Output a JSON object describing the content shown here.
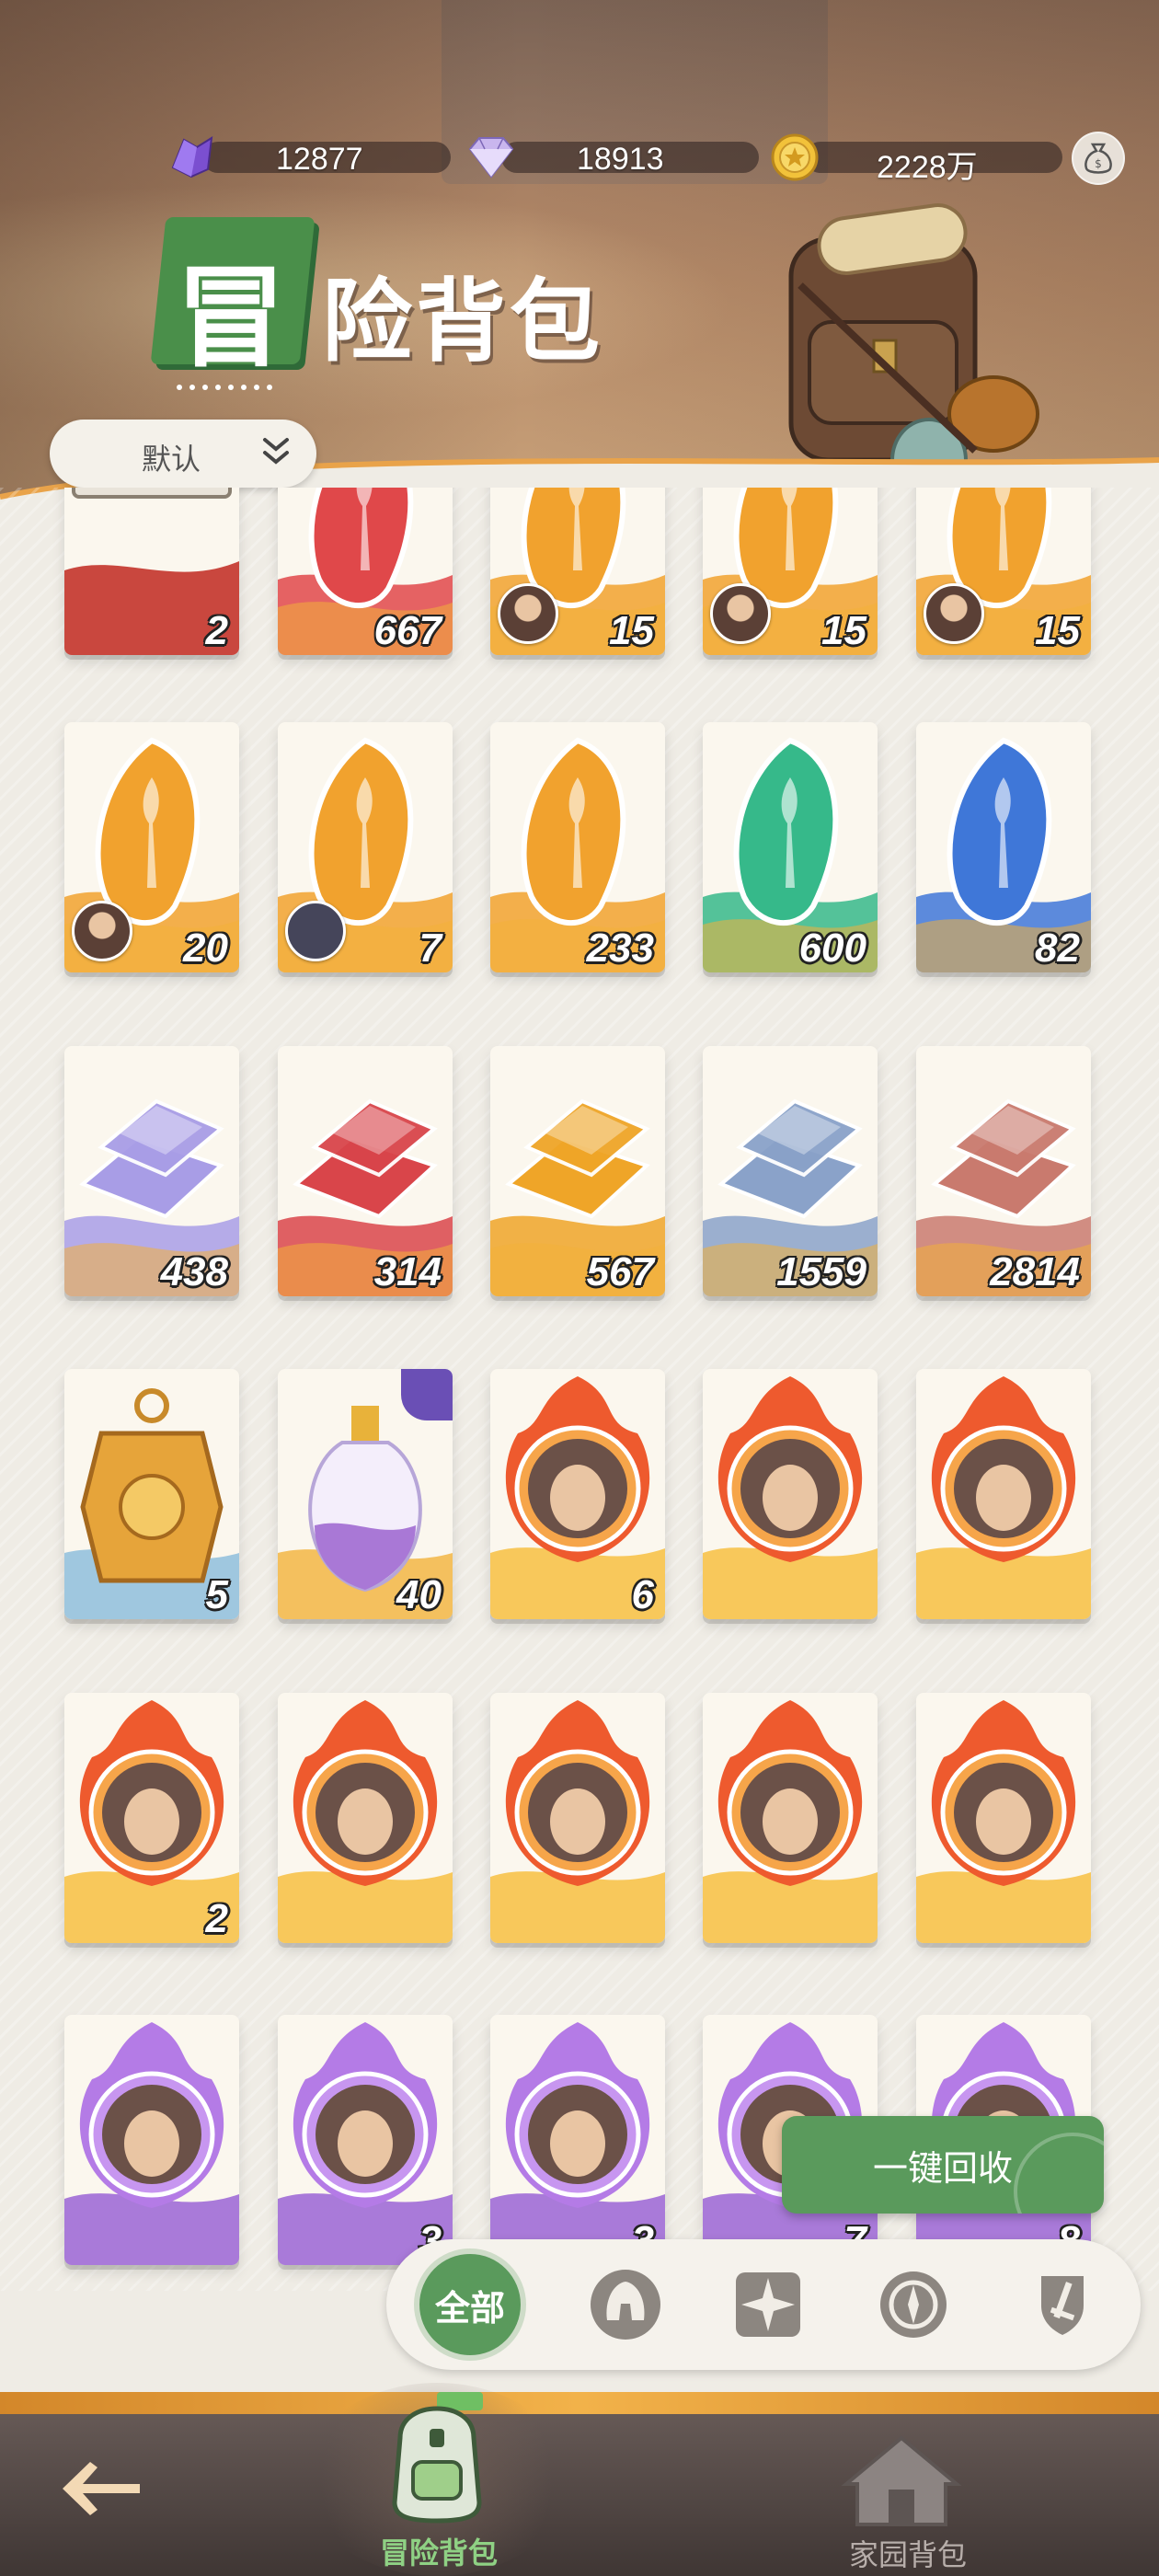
{
  "currencies": {
    "purple": {
      "value": "12877",
      "icon": "purple-crystal-icon"
    },
    "diamond": {
      "value": "18913",
      "icon": "diamond-icon"
    },
    "gold": {
      "value": "2228万",
      "icon": "gold-coin-icon"
    },
    "bag_button_icon": "money-bag-icon"
  },
  "title": {
    "first_char": "冒",
    "rest": "险背包"
  },
  "sort": {
    "label": "默认"
  },
  "items": [
    {
      "count": "2",
      "kind": "building",
      "color": "#c9543e"
    },
    {
      "count": "667",
      "kind": "shard",
      "color": "#e0484a"
    },
    {
      "count": "15",
      "kind": "shard",
      "color": "#f1a22e",
      "badge": "avatar"
    },
    {
      "count": "15",
      "kind": "shard",
      "color": "#f1a22e",
      "badge": "avatar"
    },
    {
      "count": "15",
      "kind": "shard",
      "color": "#f1a22e",
      "badge": "avatar"
    },
    {
      "count": "20",
      "kind": "shard",
      "color": "#f1a22e",
      "badge": "avatar"
    },
    {
      "count": "7",
      "kind": "shard",
      "color": "#f1a22e",
      "badge": "puzzle"
    },
    {
      "count": "233",
      "kind": "shard",
      "color": "#f1a22e"
    },
    {
      "count": "600",
      "kind": "shard",
      "color": "#36b98a"
    },
    {
      "count": "82",
      "kind": "shard",
      "color": "#3f77d8"
    },
    {
      "count": "438",
      "kind": "ingot",
      "color": "#a89de6"
    },
    {
      "count": "314",
      "kind": "ingot",
      "color": "#d9454a"
    },
    {
      "count": "567",
      "kind": "ingot",
      "color": "#efa528"
    },
    {
      "count": "1559",
      "kind": "ingot",
      "color": "#8aa2c9"
    },
    {
      "count": "2814",
      "kind": "ingot",
      "color": "#c97a6e"
    },
    {
      "count": "5",
      "kind": "medal",
      "color": "#e6a43a"
    },
    {
      "count": "40",
      "kind": "potion",
      "color": "#a978d6",
      "corner": true
    },
    {
      "count": "6",
      "kind": "hero-fire",
      "color": "#f08a2a"
    },
    {
      "count": "",
      "kind": "hero-fire",
      "color": "#f08a2a"
    },
    {
      "count": "",
      "kind": "hero-fire",
      "color": "#f08a2a"
    },
    {
      "count": "2",
      "kind": "hero-fire",
      "color": "#f08a2a"
    },
    {
      "count": "",
      "kind": "hero-fire",
      "color": "#f08a2a"
    },
    {
      "count": "",
      "kind": "hero-fire",
      "color": "#f08a2a"
    },
    {
      "count": "",
      "kind": "hero-fire",
      "color": "#f08a2a"
    },
    {
      "count": "",
      "kind": "hero-fire",
      "color": "#f08a2a"
    },
    {
      "count": "",
      "kind": "hero-purple",
      "color": "#9b63d6"
    },
    {
      "count": "3",
      "kind": "hero-purple",
      "color": "#9b63d6"
    },
    {
      "count": "3",
      "kind": "hero-purple",
      "color": "#9b63d6"
    },
    {
      "count": "7",
      "kind": "hero-purple",
      "color": "#9b63d6"
    },
    {
      "count": "8",
      "kind": "hero-purple",
      "color": "#9b63d6"
    }
  ],
  "recycle_button": {
    "label": "一键回收"
  },
  "filters": {
    "all_label": "全部",
    "icons": [
      "helmet-filter-icon",
      "star-compass-filter-icon",
      "compass-filter-icon",
      "sword-shield-filter-icon"
    ]
  },
  "nav": {
    "back_icon": "back-arrow-icon",
    "adventure_label": "冒险背包",
    "home_label": "家园背包"
  },
  "colors": {
    "accent_green": "#5a9a5c",
    "title_green": "#4a8f4a",
    "nav_active": "#8fd184"
  }
}
